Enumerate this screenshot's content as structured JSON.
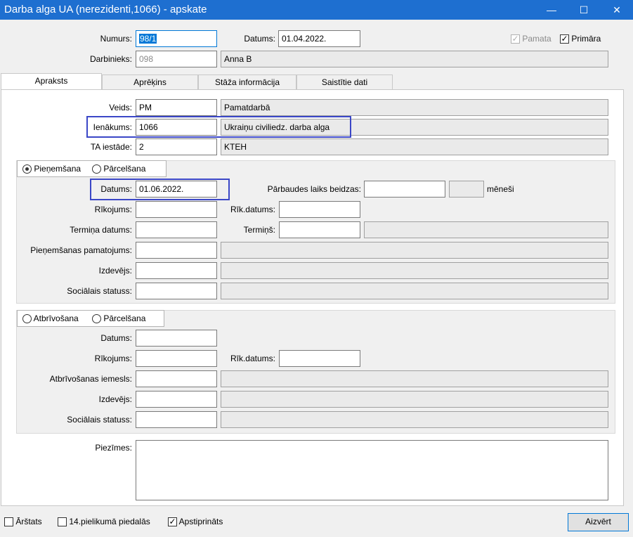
{
  "window": {
    "title": "Darba alga UA (nerezidenti,1066) - apskate",
    "minimize": "—",
    "maximize": "☐",
    "close": "✕"
  },
  "header": {
    "numurs_label": "Numurs:",
    "numurs_value": "98/1",
    "datums_label": "Datums:",
    "datums_value": "01.04.2022.",
    "pamata_label": "Pamata",
    "pamata_checked": true,
    "primara_label": "Primāra",
    "primara_checked": true,
    "darbinieks_label": "Darbinieks:",
    "darbinieks_code": "098",
    "darbinieks_name": "Anna B"
  },
  "tabs": [
    {
      "label": "Apraksts",
      "active": true
    },
    {
      "label": "Aprēķins",
      "active": false
    },
    {
      "label": "Stāža informācija",
      "active": false
    },
    {
      "label": "Saistītie dati",
      "active": false
    }
  ],
  "apraksts": {
    "veids_label": "Veids:",
    "veids_code": "PM",
    "veids_name": "Pamatdarbā",
    "ienakums_label": "Ienākums:",
    "ienakums_code": "1066",
    "ienakums_name": "Ukraiņu civiliedz. darba alga",
    "ta_label": "TA iestāde:",
    "ta_code": "2",
    "ta_name": "KTEH"
  },
  "pienemsana": {
    "radio1": "Pieņemšana",
    "radio2": "Pārcelšana",
    "datums_label": "Datums:",
    "datums_value": "01.06.2022.",
    "parbaudes_label": "Pārbaudes laiks beidzas:",
    "parbaudes_value": "",
    "meneši_value": "",
    "meneši_label": "mēneši",
    "rikojums_label": "Rīkojums:",
    "rikojums_value": "",
    "rik_datums_label": "Rīk.datums:",
    "rik_datums_value": "",
    "termina_datums_label": "Termiņa datums:",
    "termina_datums_value": "",
    "termins_label": "Termiņš:",
    "termins_value": "",
    "termins_desc": "",
    "pamatojums_label": "Pieņemšanas pamatojums:",
    "pamatojums_code": "",
    "pamatojums_desc": "",
    "izdevejs_label": "Izdevējs:",
    "izdevejs_code": "",
    "izdevejs_desc": "",
    "socialais_label": "Sociālais statuss:",
    "socialais_code": "",
    "socialais_desc": ""
  },
  "atbrivosana": {
    "radio1": "Atbrīvošana",
    "radio2": "Pārcelšana",
    "datums_label": "Datums:",
    "datums_value": "",
    "rikojums_label": "Rīkojums:",
    "rikojums_value": "",
    "rik_datums_label": "Rīk.datums:",
    "rik_datums_value": "",
    "iemesls_label": "Atbrīvošanas iemesls:",
    "iemesls_code": "",
    "iemesls_desc": "",
    "izdevejs_label": "Izdevējs:",
    "izdevejs_code": "",
    "izdevejs_desc": "",
    "socialais_label": "Sociālais statuss:",
    "socialais_code": "",
    "socialais_desc": ""
  },
  "piezimes": {
    "label": "Piezīmes:",
    "value": ""
  },
  "footer": {
    "arstats_label": "Ārštats",
    "arstats_checked": false,
    "pielikums_label": "14.pielikumā piedalās",
    "pielikums_checked": false,
    "apstiprinats_label": "Apstiprināts",
    "apstiprinats_checked": true,
    "close_button": "Aizvērt"
  },
  "colors": {
    "titlebar": "#1e6fd0",
    "highlight_box": "#3b47c7",
    "focus": "#0078d7"
  }
}
